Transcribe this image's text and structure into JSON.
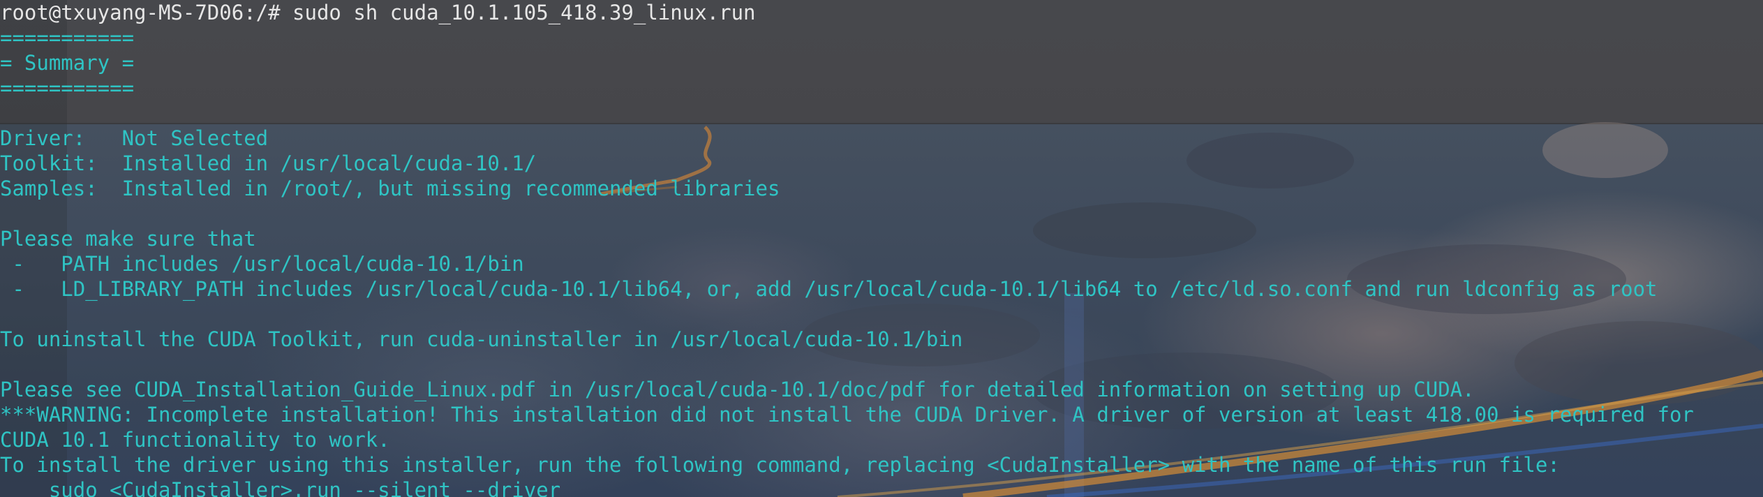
{
  "terminal": {
    "lines": [
      "root@txuyang-MS-7D06:/# sudo sh cuda_10.1.105_418.39_linux.run",
      "===========",
      "= Summary =",
      "===========",
      "",
      "Driver:   Not Selected",
      "Toolkit:  Installed in /usr/local/cuda-10.1/",
      "Samples:  Installed in /root/, but missing recommended libraries",
      "",
      "Please make sure that",
      " -   PATH includes /usr/local/cuda-10.1/bin",
      " -   LD_LIBRARY_PATH includes /usr/local/cuda-10.1/lib64, or, add /usr/local/cuda-10.1/lib64 to /etc/ld.so.conf and run ldconfig as root",
      "",
      "To uninstall the CUDA Toolkit, run cuda-uninstaller in /usr/local/cuda-10.1/bin",
      "",
      "Please see CUDA_Installation_Guide_Linux.pdf in /usr/local/cuda-10.1/doc/pdf for detailed information on setting up CUDA.",
      "***WARNING: Incomplete installation! This installation did not install the CUDA Driver. A driver of version at least 418.00 is required for",
      "CUDA 10.1 functionality to work.",
      "To install the driver using this installer, run the following command, replacing <CudaInstaller> with the name of this run file:",
      "    sudo <CudaInstaller>.run --silent --driver"
    ]
  },
  "colors": {
    "output_text": "#2fc4c4",
    "prompt_text": "#e6e6e6"
  }
}
